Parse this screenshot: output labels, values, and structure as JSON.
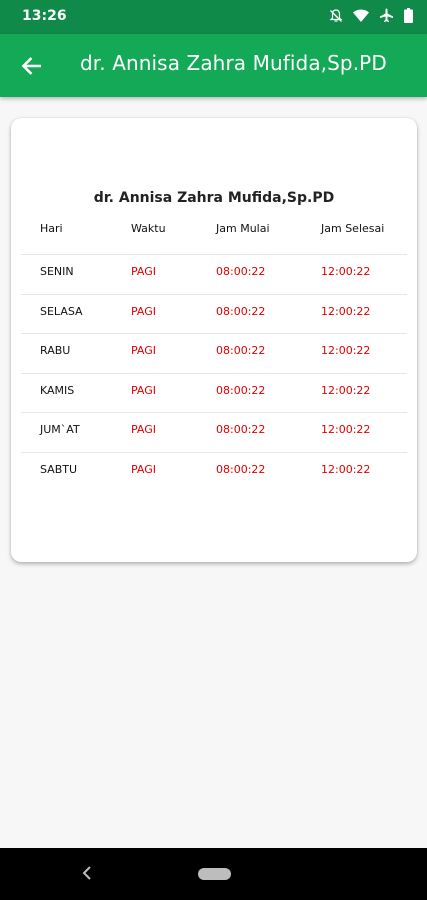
{
  "status_bar": {
    "time": "13:26",
    "icons": [
      "notifications-off-icon",
      "wifi-icon",
      "airplane-icon",
      "battery-icon"
    ]
  },
  "app_bar": {
    "title": "dr. Annisa Zahra Mufida,Sp.PD",
    "back_icon": "arrow-left-icon"
  },
  "schedule": {
    "title": "dr. Annisa Zahra Mufida,Sp.PD",
    "headers": {
      "day": "Hari",
      "shift": "Waktu",
      "start": "Jam Mulai",
      "end": "Jam Selesai"
    },
    "rows": [
      {
        "day": "SENIN",
        "shift": "PAGI",
        "start": "08:00:22",
        "end": "12:00:22"
      },
      {
        "day": "SELASA",
        "shift": "PAGI",
        "start": "08:00:22",
        "end": "12:00:22"
      },
      {
        "day": "RABU",
        "shift": "PAGI",
        "start": "08:00:22",
        "end": "12:00:22"
      },
      {
        "day": "KAMIS",
        "shift": "PAGI",
        "start": "08:00:22",
        "end": "12:00:22"
      },
      {
        "day": "JUM`AT",
        "shift": "PAGI",
        "start": "08:00:22",
        "end": "12:00:22"
      },
      {
        "day": "SABTU",
        "shift": "PAGI",
        "start": "08:00:22",
        "end": "12:00:22"
      }
    ]
  },
  "colors": {
    "status_bar": "#0f8a49",
    "app_bar": "#13a957",
    "time_text": "#e00000"
  },
  "nav_bar": {
    "icons": [
      "nav-back-icon",
      "nav-home-pill"
    ]
  }
}
